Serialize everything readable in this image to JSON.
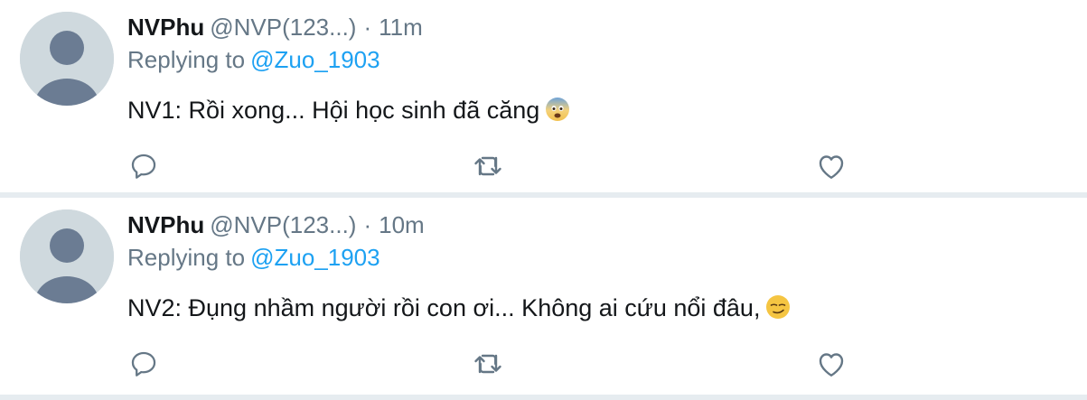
{
  "colors": {
    "name": "#14171a",
    "meta": "#657786",
    "mention": "#1da1f2",
    "divider": "#e6ecf0",
    "avatar_bg": "#cfd9de",
    "avatar_fg": "#6b7c93"
  },
  "tweets": [
    {
      "author_name": "NVPhu",
      "author_handle": "@NVP(123...)",
      "separator": "·",
      "time": "11m",
      "replying_label": "Replying to",
      "reply_to": "@Zuo_1903",
      "text": "NV1: Rồi xong... Hội học sinh đã căng",
      "emoji": "face-with-cold-sweat-icon"
    },
    {
      "author_name": "NVPhu",
      "author_handle": "@NVP(123...)",
      "separator": "·",
      "time": "10m",
      "replying_label": "Replying to",
      "reply_to": "@Zuo_1903",
      "text": "NV2: Đụng nhầm người rồi con ơi... Không ai cứu nổi đâu,",
      "emoji": "smirking-face-icon"
    }
  ],
  "icons": {
    "reply": "reply-icon",
    "retweet": "retweet-icon",
    "like": "like-heart-icon"
  }
}
